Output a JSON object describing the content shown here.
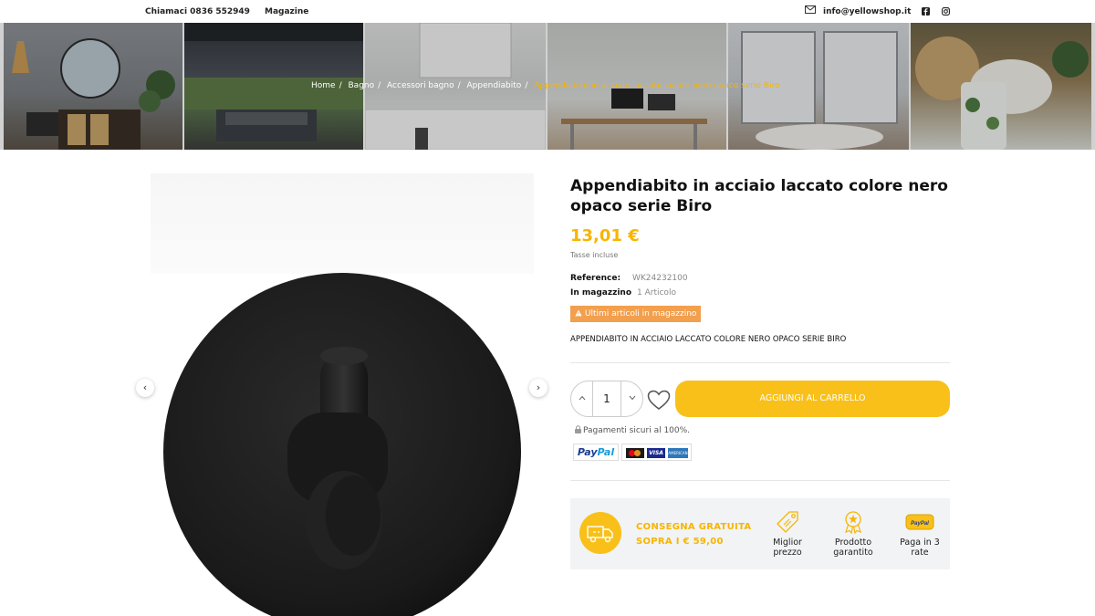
{
  "topbar": {
    "phone": "Chiamaci 0836 552949",
    "magazine": "Magazine",
    "email": "info@yellowshop.it",
    "icons": [
      "mail-icon",
      "facebook-icon",
      "instagram-icon"
    ]
  },
  "breadcrumb": {
    "items": [
      "Home",
      "Bagno",
      "Accessori bagno",
      "Appendiabito"
    ],
    "current": "Appendiabito in acciaio laccato colore nero opaco serie Biro",
    "separator": "/"
  },
  "gallery": {
    "prev": "‹",
    "next": "›"
  },
  "product": {
    "title": "Appendiabito in acciaio laccato colore nero opaco serie Biro",
    "price": "13,01 €",
    "tax_note": "Tasse incluse",
    "reference_label": "Reference:",
    "reference_value": "WK24232100",
    "stock_label": "In magazzino",
    "stock_value": "1 Articolo",
    "stock_badge": "Ultimi articoli in magazzino",
    "description": "APPENDIABITO IN ACCIAIO LACCATO COLORE NERO OPACO SERIE BIRO",
    "quantity": "1",
    "add_to_cart": "AGGIUNGI AL CARRELLO",
    "secure_payments": "Pagamenti sicuri al 100%.",
    "paypal_pay": "Pay",
    "paypal_pal": "Pal",
    "card_visa": "VISA",
    "card_amex": "AMERICAN EXPRESS"
  },
  "info": {
    "shipping_line1": "CONSEGNA GRATUITA",
    "shipping_line2": "SOPRA I € 59,00",
    "features": [
      {
        "label": "Miglior prezzo",
        "icon": "price-tag-icon"
      },
      {
        "label": "Prodotto garantito",
        "icon": "award-ribbon-icon"
      },
      {
        "label": "Paga in 3 rate",
        "icon": "paypal-badge-icon",
        "badge_text": "PayPal"
      }
    ]
  },
  "colors": {
    "accent": "#f9c019",
    "price": "#f7b500",
    "badge": "#f29f4e"
  }
}
